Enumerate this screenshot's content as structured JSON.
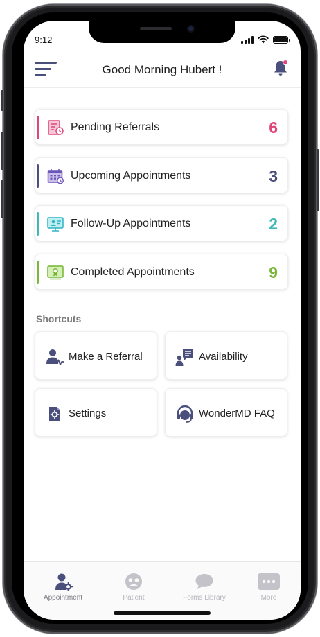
{
  "status_bar": {
    "time": "9:12"
  },
  "header": {
    "title": "Good Morning Hubert !"
  },
  "stats": [
    {
      "label": "Pending Referrals",
      "count": "6",
      "color": "#e0457b",
      "icon": "referral-document-icon"
    },
    {
      "label": "Upcoming Appointments",
      "count": "3",
      "color": "#4a4f7c",
      "icon": "calendar-icon"
    },
    {
      "label": "Follow-Up Appointments",
      "count": "2",
      "color": "#3fb8b8",
      "icon": "monitor-user-icon"
    },
    {
      "label": "Completed Appointments",
      "count": "9",
      "color": "#7bb63d",
      "icon": "completed-certificate-icon"
    }
  ],
  "shortcuts": {
    "title": "Shortcuts",
    "items": [
      {
        "label": "Make a Referral",
        "icon": "user-referral-icon"
      },
      {
        "label": "Availability",
        "icon": "user-availability-icon"
      },
      {
        "label": "Settings",
        "icon": "settings-icon"
      },
      {
        "label": "WonderMD FAQ",
        "icon": "headset-icon"
      }
    ]
  },
  "bottom_nav": {
    "items": [
      {
        "label": "Appointment",
        "icon": "appointment-user-gear-icon",
        "active": true
      },
      {
        "label": "Patient",
        "icon": "patient-icon",
        "active": false
      },
      {
        "label": "Forms Library",
        "icon": "chat-bubble-icon",
        "active": false
      },
      {
        "label": "More",
        "icon": "more-dots-icon",
        "active": false
      }
    ]
  },
  "colors": {
    "primary": "#4a4f7c",
    "notification_dot": "#e0457b",
    "nav_inactive": "#c3c3c9"
  }
}
